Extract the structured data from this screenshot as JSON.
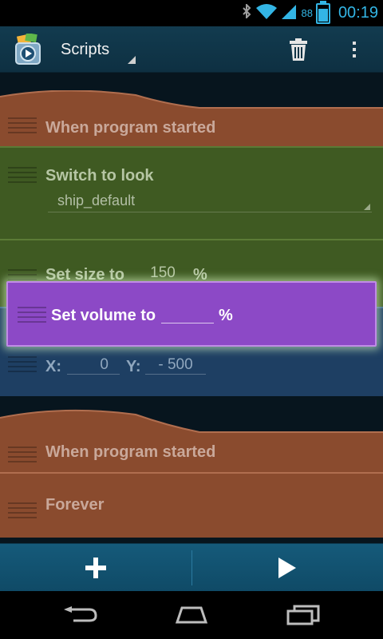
{
  "status_bar": {
    "battery_level": "88",
    "time": "00:19",
    "icons": [
      "bluetooth-icon",
      "wifi-icon",
      "signal-icon",
      "battery-icon"
    ]
  },
  "action_bar": {
    "title": "Scripts",
    "icons": [
      "app-logo-icon",
      "trash-icon",
      "overflow-menu-icon"
    ]
  },
  "bricks": {
    "when_started_1": {
      "label": "When program started"
    },
    "switch_to_look": {
      "label": "Switch to look",
      "look_value": "ship_default"
    },
    "set_size": {
      "label": "Set size to",
      "value": "150",
      "unit": "%"
    },
    "set_volume": {
      "label": "Set volume to",
      "value": "",
      "unit": "%"
    },
    "place_at": {
      "x_label": "X:",
      "x_value": "0",
      "y_label": "Y:",
      "y_value": "- 500"
    },
    "when_started_2": {
      "label": "When program started"
    },
    "forever": {
      "label": "Forever"
    }
  },
  "bottom_bar": {
    "add_icon": "plus-icon",
    "play_icon": "play-icon"
  },
  "colors": {
    "control": "#8a4b2e",
    "looks": "#3f5a22",
    "motion": "#1e3f63",
    "sound": "#8c49c6",
    "accent": "#33b5e5"
  }
}
